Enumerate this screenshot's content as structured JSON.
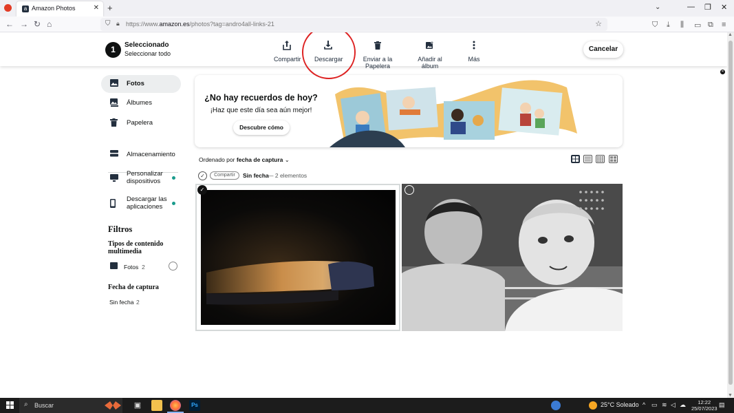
{
  "browser": {
    "tab_title": "Amazon Photos",
    "tab_close": "✕",
    "new_tab": "+",
    "url_prefix": "https://www.",
    "url_domain": "amazon.es",
    "url_rest": "/photos?tag=andro4all-links-21"
  },
  "selection_bar": {
    "count": "1",
    "title": "Seleccionado",
    "select_all": "Seleccionar todo",
    "actions": [
      {
        "label": "Compartir",
        "icon": "share-icon"
      },
      {
        "label": "Descargar",
        "icon": "download-icon"
      },
      {
        "label": "Enviar a la Papelera",
        "icon": "trash-icon"
      },
      {
        "label": "Añadir al álbum",
        "icon": "add-to-album-icon"
      },
      {
        "label": "Más",
        "icon": "more-icon"
      }
    ],
    "cancel": "Cancelar",
    "highlight_color": "#d22222"
  },
  "sidebar": {
    "items": [
      {
        "label": "Fotos",
        "icon": "photos-icon"
      },
      {
        "label": "Álbumes",
        "icon": "albums-icon"
      },
      {
        "label": "Papelera",
        "icon": "trash-icon"
      },
      {
        "label": "Almacenamiento",
        "icon": "storage-icon"
      },
      {
        "label": "Personalizar dispositivos",
        "icon": "device-icon"
      },
      {
        "label": "Descargar las aplicaciones",
        "icon": "phone-icon"
      }
    ],
    "accent": "#1a9b8c"
  },
  "filters": {
    "title": "Filtros",
    "media_type_heading": "Tipos de contenido multimedia",
    "media_type_item": "Fotos",
    "media_type_count": "2",
    "date_heading": "Fecha de captura",
    "date_item": "Sin fecha",
    "date_count": "2"
  },
  "banner": {
    "title": "¿No hay recuerdos de hoy?",
    "subtitle": "¡Haz que este día sea aún mejor!",
    "button": "Descubre cómo"
  },
  "sort": {
    "prefix": "Ordenado por",
    "value": "fecha de captura"
  },
  "group": {
    "share": "Compartir",
    "title": "Sin fecha",
    "meta": "— 2 elementos"
  },
  "taskbar": {
    "search": "Buscar",
    "weather": "25°C  Soleado",
    "time": "12:22",
    "date": "25/07/2023"
  }
}
